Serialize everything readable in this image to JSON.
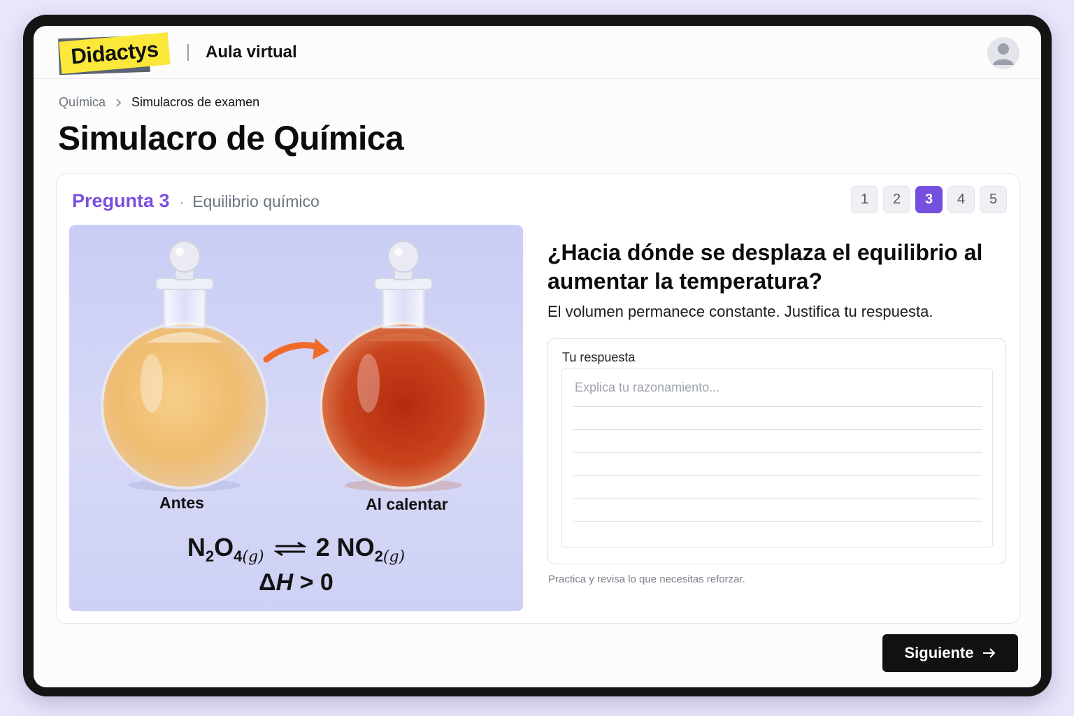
{
  "header": {
    "logo_text": "Didactys",
    "app_name": "Aula virtual",
    "avatar_icon": "user-avatar-icon"
  },
  "breadcrumb": {
    "parent": "Química",
    "current": "Simulacros de examen"
  },
  "page": {
    "title": "Simulacro de Química"
  },
  "question": {
    "label": "Pregunta 3",
    "topic": "Equilibrio químico",
    "pages": [
      "1",
      "2",
      "3",
      "4",
      "5"
    ],
    "current_page": "3",
    "title": "¿Hacia dónde se desplaza el equilibrio al aumentar la temperatura?",
    "subtitle": "El volumen permanece constante. Justifica tu respuesta."
  },
  "illustration": {
    "label_before": "Antes",
    "label_after": "Al calentar",
    "equation": {
      "reactant": "N",
      "reactant_sub1": "2",
      "reactant_mid": "O",
      "reactant_sub2": "4",
      "state_reactant": "(g)",
      "product_coef": "2 NO",
      "product_sub": "2",
      "state_product": "(g)"
    },
    "enthalpy": {
      "symbol": "Δ",
      "var": "H",
      "rest": " > 0"
    },
    "colors": {
      "before": "#f2c27a",
      "after": "#c2391a",
      "arrow": "#f06a2a"
    }
  },
  "answer": {
    "label": "Tu respuesta",
    "placeholder": "Explica tu razonamiento...",
    "value": "",
    "hint": "Practica y revisa lo que necesitas reforzar."
  },
  "actions": {
    "next_label": "Siguiente",
    "next_icon": "arrow-right-icon"
  },
  "theme": {
    "accent": "#7550e0",
    "logo_bg": "#fbe83a"
  }
}
